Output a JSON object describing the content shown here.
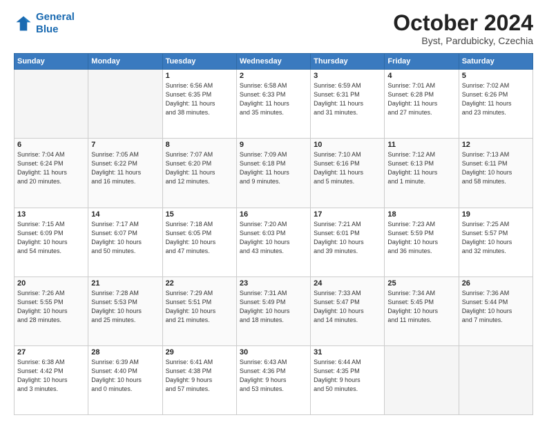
{
  "header": {
    "logo_line1": "General",
    "logo_line2": "Blue",
    "title": "October 2024",
    "subtitle": "Byst, Pardubicky, Czechia"
  },
  "weekdays": [
    "Sunday",
    "Monday",
    "Tuesday",
    "Wednesday",
    "Thursday",
    "Friday",
    "Saturday"
  ],
  "weeks": [
    [
      {
        "day": "",
        "info": ""
      },
      {
        "day": "",
        "info": ""
      },
      {
        "day": "1",
        "info": "Sunrise: 6:56 AM\nSunset: 6:35 PM\nDaylight: 11 hours\nand 38 minutes."
      },
      {
        "day": "2",
        "info": "Sunrise: 6:58 AM\nSunset: 6:33 PM\nDaylight: 11 hours\nand 35 minutes."
      },
      {
        "day": "3",
        "info": "Sunrise: 6:59 AM\nSunset: 6:31 PM\nDaylight: 11 hours\nand 31 minutes."
      },
      {
        "day": "4",
        "info": "Sunrise: 7:01 AM\nSunset: 6:28 PM\nDaylight: 11 hours\nand 27 minutes."
      },
      {
        "day": "5",
        "info": "Sunrise: 7:02 AM\nSunset: 6:26 PM\nDaylight: 11 hours\nand 23 minutes."
      }
    ],
    [
      {
        "day": "6",
        "info": "Sunrise: 7:04 AM\nSunset: 6:24 PM\nDaylight: 11 hours\nand 20 minutes."
      },
      {
        "day": "7",
        "info": "Sunrise: 7:05 AM\nSunset: 6:22 PM\nDaylight: 11 hours\nand 16 minutes."
      },
      {
        "day": "8",
        "info": "Sunrise: 7:07 AM\nSunset: 6:20 PM\nDaylight: 11 hours\nand 12 minutes."
      },
      {
        "day": "9",
        "info": "Sunrise: 7:09 AM\nSunset: 6:18 PM\nDaylight: 11 hours\nand 9 minutes."
      },
      {
        "day": "10",
        "info": "Sunrise: 7:10 AM\nSunset: 6:16 PM\nDaylight: 11 hours\nand 5 minutes."
      },
      {
        "day": "11",
        "info": "Sunrise: 7:12 AM\nSunset: 6:13 PM\nDaylight: 11 hours\nand 1 minute."
      },
      {
        "day": "12",
        "info": "Sunrise: 7:13 AM\nSunset: 6:11 PM\nDaylight: 10 hours\nand 58 minutes."
      }
    ],
    [
      {
        "day": "13",
        "info": "Sunrise: 7:15 AM\nSunset: 6:09 PM\nDaylight: 10 hours\nand 54 minutes."
      },
      {
        "day": "14",
        "info": "Sunrise: 7:17 AM\nSunset: 6:07 PM\nDaylight: 10 hours\nand 50 minutes."
      },
      {
        "day": "15",
        "info": "Sunrise: 7:18 AM\nSunset: 6:05 PM\nDaylight: 10 hours\nand 47 minutes."
      },
      {
        "day": "16",
        "info": "Sunrise: 7:20 AM\nSunset: 6:03 PM\nDaylight: 10 hours\nand 43 minutes."
      },
      {
        "day": "17",
        "info": "Sunrise: 7:21 AM\nSunset: 6:01 PM\nDaylight: 10 hours\nand 39 minutes."
      },
      {
        "day": "18",
        "info": "Sunrise: 7:23 AM\nSunset: 5:59 PM\nDaylight: 10 hours\nand 36 minutes."
      },
      {
        "day": "19",
        "info": "Sunrise: 7:25 AM\nSunset: 5:57 PM\nDaylight: 10 hours\nand 32 minutes."
      }
    ],
    [
      {
        "day": "20",
        "info": "Sunrise: 7:26 AM\nSunset: 5:55 PM\nDaylight: 10 hours\nand 28 minutes."
      },
      {
        "day": "21",
        "info": "Sunrise: 7:28 AM\nSunset: 5:53 PM\nDaylight: 10 hours\nand 25 minutes."
      },
      {
        "day": "22",
        "info": "Sunrise: 7:29 AM\nSunset: 5:51 PM\nDaylight: 10 hours\nand 21 minutes."
      },
      {
        "day": "23",
        "info": "Sunrise: 7:31 AM\nSunset: 5:49 PM\nDaylight: 10 hours\nand 18 minutes."
      },
      {
        "day": "24",
        "info": "Sunrise: 7:33 AM\nSunset: 5:47 PM\nDaylight: 10 hours\nand 14 minutes."
      },
      {
        "day": "25",
        "info": "Sunrise: 7:34 AM\nSunset: 5:45 PM\nDaylight: 10 hours\nand 11 minutes."
      },
      {
        "day": "26",
        "info": "Sunrise: 7:36 AM\nSunset: 5:44 PM\nDaylight: 10 hours\nand 7 minutes."
      }
    ],
    [
      {
        "day": "27",
        "info": "Sunrise: 6:38 AM\nSunset: 4:42 PM\nDaylight: 10 hours\nand 3 minutes."
      },
      {
        "day": "28",
        "info": "Sunrise: 6:39 AM\nSunset: 4:40 PM\nDaylight: 10 hours\nand 0 minutes."
      },
      {
        "day": "29",
        "info": "Sunrise: 6:41 AM\nSunset: 4:38 PM\nDaylight: 9 hours\nand 57 minutes."
      },
      {
        "day": "30",
        "info": "Sunrise: 6:43 AM\nSunset: 4:36 PM\nDaylight: 9 hours\nand 53 minutes."
      },
      {
        "day": "31",
        "info": "Sunrise: 6:44 AM\nSunset: 4:35 PM\nDaylight: 9 hours\nand 50 minutes."
      },
      {
        "day": "",
        "info": ""
      },
      {
        "day": "",
        "info": ""
      }
    ]
  ]
}
